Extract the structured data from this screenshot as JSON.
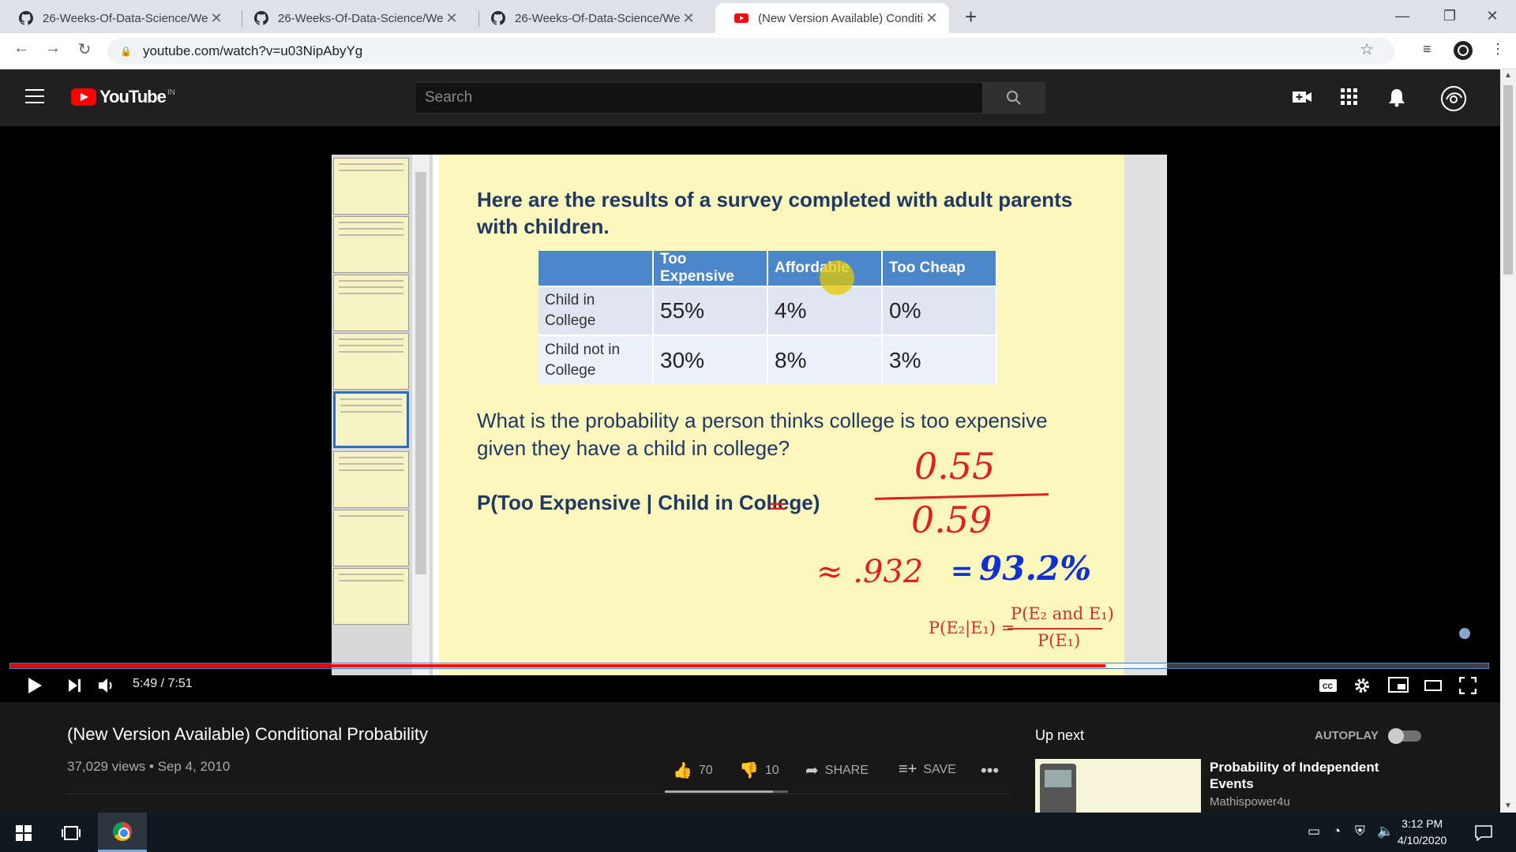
{
  "browser": {
    "tabs": [
      {
        "title": "26-Weeks-Of-Data-Science/Weel",
        "favicon": "github-icon"
      },
      {
        "title": "26-Weeks-Of-Data-Science/Weel",
        "favicon": "github-icon"
      },
      {
        "title": "26-Weeks-Of-Data-Science/Weel",
        "favicon": "github-icon"
      },
      {
        "title": "(New Version Available) Conditio",
        "favicon": "youtube-icon",
        "active": true
      }
    ],
    "url": "youtube.com/watch?v=u03NipAbyYg"
  },
  "youtube": {
    "logo_text": "YouTube",
    "region": "IN",
    "search_placeholder": "Search"
  },
  "slide": {
    "heading": "Here are the results of a survey completed with adult parents with children.",
    "table": {
      "headers": [
        "",
        "Too Expensive",
        "Affordable",
        "Too Cheap"
      ],
      "rows": [
        {
          "label": "Child in College",
          "values": [
            "55%",
            "4%",
            "0%"
          ]
        },
        {
          "label": "Child not in College",
          "values": [
            "30%",
            "8%",
            "3%"
          ]
        }
      ]
    },
    "question": "What is the probability a person thinks college is too expensive given they have a child in college?",
    "prob_expr": "P(Too Expensive | Child in College)",
    "ink": {
      "equals": "=",
      "numerator": "0.55",
      "denominator": "0.59",
      "approx": "≈ .932",
      "equals2": "=",
      "percent": "93.2%"
    },
    "formula": {
      "lhs": "P(E₂|E₁) =",
      "numerator": "P(E₂ and E₁)",
      "denominator": "P(E₁)"
    }
  },
  "player": {
    "time": "5:49 / 7:51",
    "played_fraction": 0.741,
    "buffered_fraction": 0.78
  },
  "video": {
    "title": "(New Version Available) Conditional Probability",
    "meta": "37,029 views • Sep 4, 2010",
    "likes": "70",
    "dislikes": "10",
    "like_ratio": 0.875,
    "share_label": "SHARE",
    "save_label": "SAVE"
  },
  "sidebar": {
    "up_next_label": "Up next",
    "autoplay_label": "AUTOPLAY",
    "next_video": {
      "title": "Probability of Independent Events",
      "channel": "Mathispower4u"
    }
  },
  "taskbar": {
    "time": "3:12 PM",
    "date": "4/10/2020"
  }
}
